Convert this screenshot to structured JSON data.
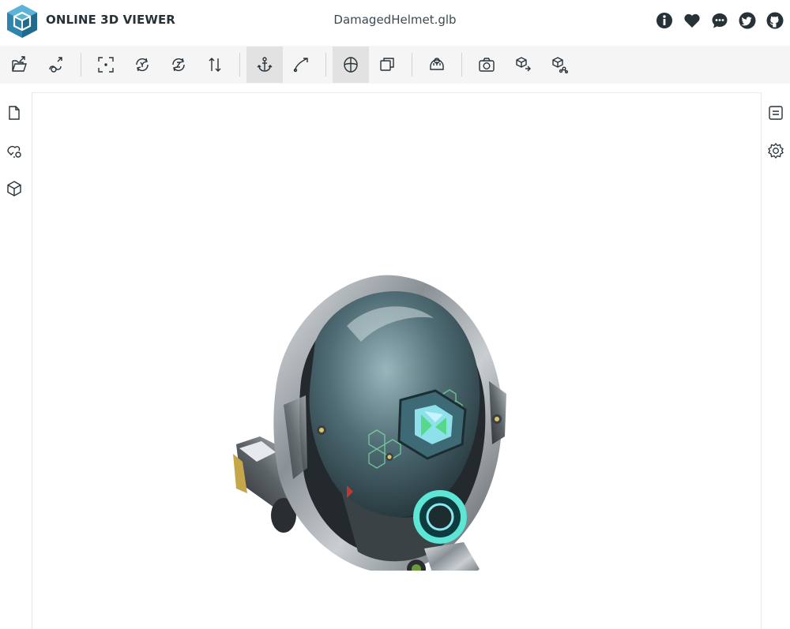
{
  "app": {
    "brand": "ONLINE 3D VIEWER",
    "filename": "DamagedHelmet.glb",
    "brand_color": "#3393bd"
  },
  "header_icons": [
    {
      "name": "info-icon"
    },
    {
      "name": "heart-icon"
    },
    {
      "name": "feedback-icon"
    },
    {
      "name": "twitter-icon"
    },
    {
      "name": "github-icon"
    }
  ],
  "toolbar": {
    "groups": [
      [
        "open-file",
        "open-url"
      ],
      [
        "fit-to-window",
        "set-up-y",
        "set-up-z",
        "flip-up"
      ],
      [
        "fixed-up-vector",
        "free-orbit"
      ],
      [
        "perspective-camera",
        "orthographic-camera"
      ],
      [
        "measure"
      ],
      [
        "export-snapshot",
        "export-model",
        "share-model"
      ]
    ],
    "selected": [
      "fixed-up-vector",
      "perspective-camera"
    ]
  },
  "left_sidebar": [
    "files",
    "materials",
    "meshes"
  ],
  "right_sidebar": [
    "details",
    "settings"
  ],
  "viewport": {
    "background": "#ffffff",
    "model": "damaged-helmet"
  }
}
